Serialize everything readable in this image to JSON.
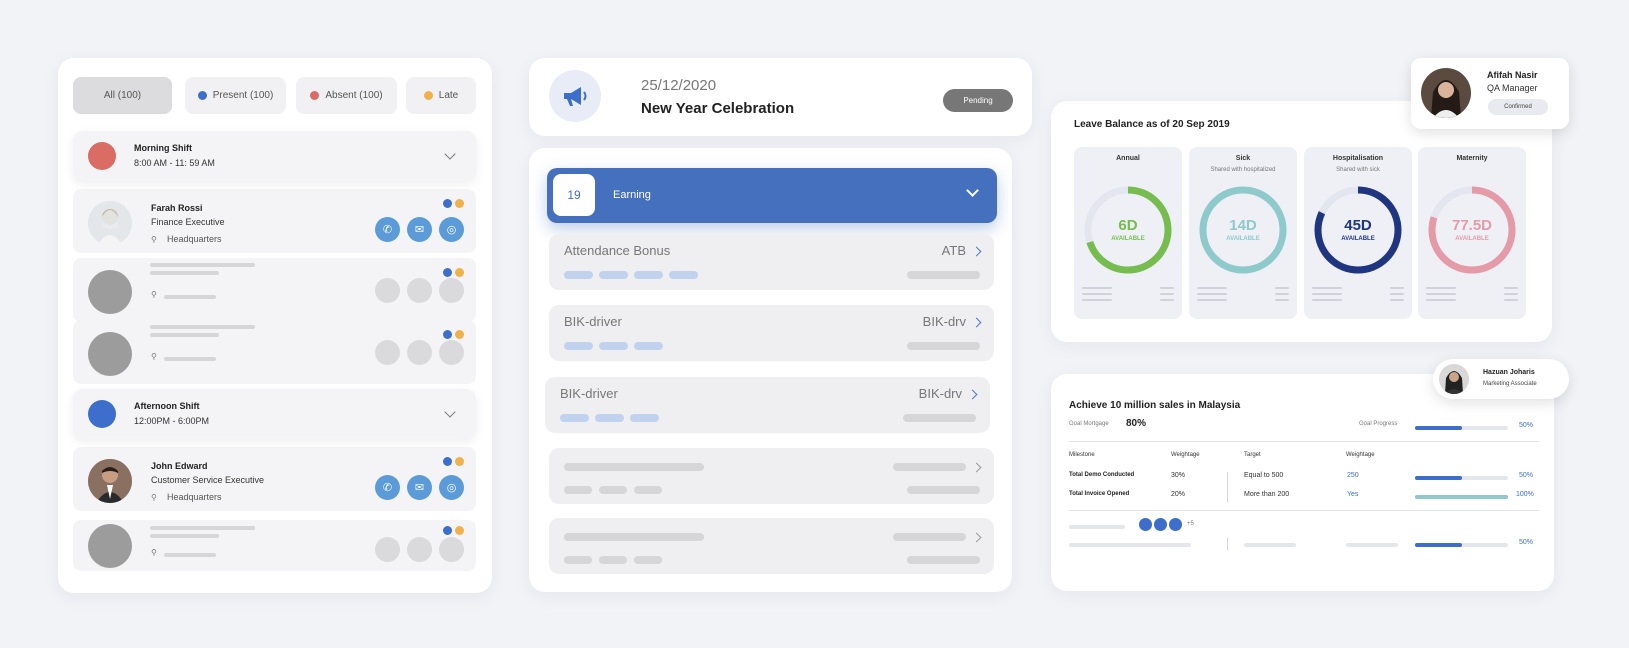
{
  "attendance": {
    "filters": [
      {
        "label": "All (100)"
      },
      {
        "label": "Present (100)",
        "color": "#3d6ecb"
      },
      {
        "label": "Absent (100)",
        "color": "#db6b65"
      },
      {
        "label": "Late",
        "color": "#f0b04a"
      }
    ],
    "morning_shift": {
      "title": "Morning Shift",
      "time": "8:00 AM - 11: 59 AM",
      "color": "#db6b65"
    },
    "afternoon_shift": {
      "title": "Afternoon Shift",
      "time": "12:00PM - 6:00PM",
      "color": "#3d6ecb"
    },
    "employees": [
      {
        "name": "Farah Rossi",
        "role": "Finance Executive",
        "location": "Headquarters"
      },
      {
        "name": "John Edward",
        "role": "Customer Service Executive",
        "location": "Headquarters"
      }
    ]
  },
  "event": {
    "date": "25/12/2020",
    "title": "New Year Celebration",
    "status": "Pending",
    "icon": "megaphone-icon"
  },
  "payroll": {
    "header": {
      "day": "19",
      "label": "Earning"
    },
    "items": [
      {
        "label": "Attendance Bonus",
        "code": "ATB"
      },
      {
        "label": "BIK-driver",
        "code": "BIK-drv"
      },
      {
        "label": "BIK-driver",
        "code": "BIK-drv"
      }
    ]
  },
  "leave": {
    "title": "Leave Balance as of 20 Sep 2019",
    "types": [
      {
        "name": "Annual",
        "sub": "",
        "value": "6D",
        "status": "AVAILABLE",
        "color": "#76bc4e",
        "fraction": 0.7
      },
      {
        "name": "Sick",
        "sub": "Shared with hospitalized",
        "value": "14D",
        "status": "AVAILABLE",
        "color": "#8ec9cc",
        "fraction": 1
      },
      {
        "name": "Hospitalisation",
        "sub": "Shared with sick",
        "value": "45D",
        "status": "AVAILABLE",
        "color": "#1f3580",
        "fraction": 0.82
      },
      {
        "name": "Maternity",
        "sub": "",
        "value": "77.5D",
        "status": "AVAILABLE",
        "color": "#e59aa8",
        "fraction": 0.8
      }
    ]
  },
  "approver": {
    "name": "Afifah Nasir",
    "role": "QA Manager",
    "status": "Confirmed"
  },
  "goal": {
    "title": "Achieve 10 million sales in Malaysia",
    "mortgage_label": "Goal Mortgage",
    "mortgage_value": "80%",
    "progress_label": "Goal Progress",
    "progress_value": "50%",
    "progress": 0.5,
    "headers": {
      "milestone": "Milestone",
      "weightage": "Weightage",
      "target": "Target",
      "weightage2": "Weightage"
    },
    "milestones": [
      {
        "name": "Total Demo Conducted",
        "weightage": "30%",
        "target": "Equal to 500",
        "value": "250",
        "progress": 0.5,
        "pct": "50%"
      },
      {
        "name": "Total Invoice Opened",
        "weightage": "20%",
        "target": "More than 200",
        "value": "Yes",
        "progress": 1,
        "pct": "100%"
      }
    ],
    "extra_count": "+5",
    "footer_pct": "50%",
    "footer_progress": 0.5
  },
  "assignee": {
    "name": "Hazuan Joharis",
    "role": "Marketing Associate"
  }
}
